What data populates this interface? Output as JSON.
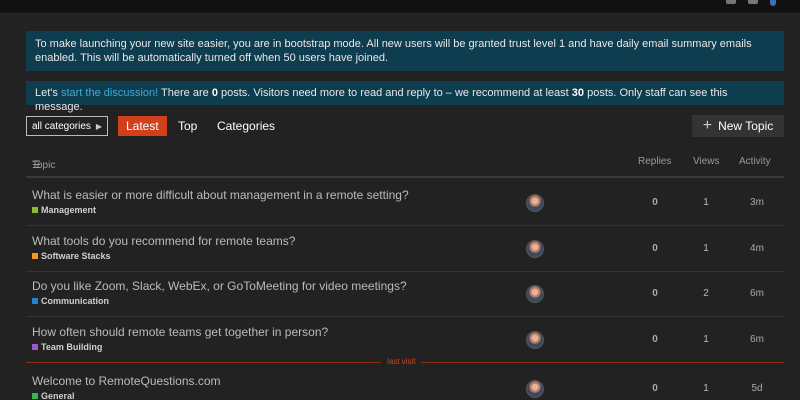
{
  "banners": {
    "bootstrap": "To make launching your new site easier, you are in bootstrap mode. All new users will be granted trust level 1 and have daily email summary emails enabled. This will be automatically turned off when 50 users have joined.",
    "discussion": {
      "prefix": "Let's",
      "link": "start the discussion!",
      "t1": "There are",
      "posts_count": "0",
      "t2": "posts. Visitors need more to read and reply to – we recommend at least",
      "recommended": "30",
      "t3": "posts. Only staff can see this message."
    }
  },
  "nav": {
    "category_dropdown": "all categories",
    "tabs": [
      "Latest",
      "Top",
      "Categories"
    ],
    "active_tab": "Latest",
    "new_topic": "New Topic"
  },
  "table": {
    "headers": {
      "topic": "Topic",
      "replies": "Replies",
      "views": "Views",
      "activity": "Activity"
    },
    "rows": [
      {
        "title": "What is easier or more difficult about management in a remote setting?",
        "category": "Management",
        "category_color": "#8fbc2f",
        "replies": "0",
        "views": "1",
        "activity": "3m"
      },
      {
        "title": "What tools do you recommend for remote teams?",
        "category": "Software Stacks",
        "category_color": "#f7941d",
        "replies": "0",
        "views": "1",
        "activity": "4m"
      },
      {
        "title": "Do you like Zoom, Slack, WebEx, or GoToMeeting for video meetings?",
        "category": "Communication",
        "category_color": "#1e87c8",
        "replies": "0",
        "views": "2",
        "activity": "6m"
      },
      {
        "title": "How often should remote teams get together in person?",
        "category": "Team Building",
        "category_color": "#9b59d0",
        "replies": "0",
        "views": "1",
        "activity": "6m"
      },
      {
        "title": "Welcome to RemoteQuestions.com",
        "category": "General",
        "category_color": "#3ab54a",
        "replies": "0",
        "views": "1",
        "activity": "5d"
      }
    ]
  },
  "last_visit_label": "last visit",
  "colors": {
    "accent": "#d1401b",
    "banner_bg": "#0e3d4f",
    "link": "#3fa9d6",
    "background": "#222222"
  }
}
